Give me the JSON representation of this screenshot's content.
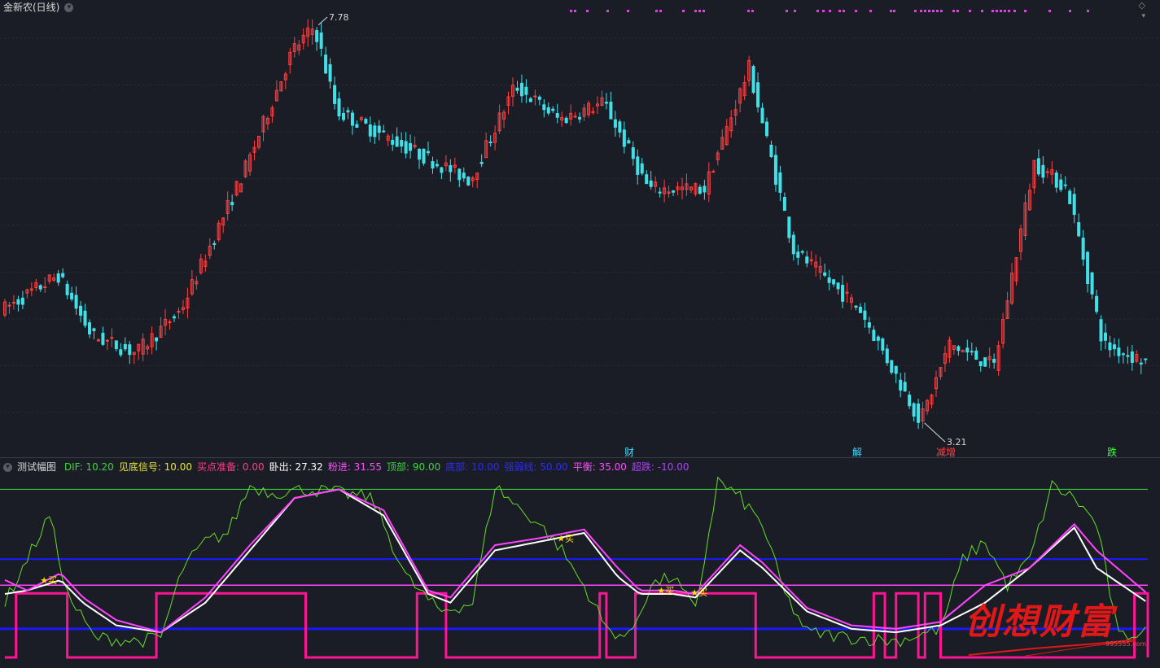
{
  "stock": {
    "title": "金新农(日线)",
    "high_label": "7.78",
    "low_label": "3.21"
  },
  "indicator": {
    "name": "测试幅图",
    "items": [
      {
        "label": "DIF:",
        "value": "10.20",
        "color": "#3cd63c"
      },
      {
        "label": "见底信号:",
        "value": "10.00",
        "color": "#e6e63a"
      },
      {
        "label": "买点准备:",
        "value": "0.00",
        "color": "#ff3c8c"
      },
      {
        "label": "卧出:",
        "value": "27.32",
        "color": "#ffffff"
      },
      {
        "label": "粉进:",
        "value": "31.55",
        "color": "#ff4cff"
      },
      {
        "label": "顶部:",
        "value": "90.00",
        "color": "#3cd63c"
      },
      {
        "label": "底部:",
        "value": "10.00",
        "color": "#2b2bff"
      },
      {
        "label": "强弱线:",
        "value": "50.00",
        "color": "#2b2bff"
      },
      {
        "label": "平衡:",
        "value": "35.00",
        "color": "#ff4cff"
      },
      {
        "label": "超跌:",
        "value": "-10.00",
        "color": "#b040ff"
      }
    ]
  },
  "markers": [
    {
      "text": "财",
      "color": "#40d8ff"
    },
    {
      "text": "解",
      "color": "#40d8ff"
    },
    {
      "text": "减增",
      "color": "#ff4040"
    },
    {
      "text": "跌",
      "color": "#40ff40"
    }
  ],
  "buy_label": "买",
  "watermark": {
    "text": "创想财富",
    "sub": "995555.com"
  },
  "colors": {
    "up": "#ff4040",
    "down": "#40e0e8",
    "white": "#ffffff",
    "magenta": "#ff44ff",
    "green": "#66dd22",
    "blue": "#1a1aff",
    "pink": "#ff1493"
  },
  "chart_data": [
    {
      "type": "candlestick",
      "anchors": [
        [
          0,
          4.5
        ],
        [
          25,
          4.9
        ],
        [
          40,
          4.2
        ],
        [
          60,
          4.0
        ],
        [
          80,
          4.5
        ],
        [
          110,
          6.2
        ],
        [
          130,
          7.5
        ],
        [
          140,
          7.78
        ],
        [
          150,
          6.8
        ],
        [
          180,
          6.4
        ],
        [
          210,
          6.0
        ],
        [
          230,
          7.1
        ],
        [
          250,
          6.7
        ],
        [
          270,
          6.9
        ],
        [
          290,
          5.9
        ],
        [
          315,
          5.9
        ],
        [
          335,
          7.3
        ],
        [
          355,
          5.2
        ],
        [
          385,
          4.5
        ],
        [
          412,
          3.21
        ],
        [
          425,
          4.1
        ],
        [
          445,
          3.85
        ],
        [
          463,
          6.2
        ],
        [
          478,
          5.9
        ],
        [
          494,
          4.1
        ],
        [
          513,
          3.9
        ]
      ]
    },
    {
      "type": "line",
      "ylim": [
        -12,
        100
      ],
      "levels": [
        90,
        50,
        35,
        10
      ],
      "series": [
        {
          "key": "green",
          "anchors": [
            [
              0,
              25
            ],
            [
              10,
              50
            ],
            [
              20,
              75
            ],
            [
              28,
              30
            ],
            [
              40,
              5
            ],
            [
              60,
              3
            ],
            [
              70,
              5
            ],
            [
              80,
              45
            ],
            [
              90,
              60
            ],
            [
              100,
              65
            ],
            [
              110,
              92
            ],
            [
              120,
              88
            ],
            [
              135,
              90
            ],
            [
              150,
              88
            ],
            [
              165,
              85
            ],
            [
              180,
              40
            ],
            [
              195,
              20
            ],
            [
              210,
              25
            ],
            [
              220,
              92
            ],
            [
              230,
              80
            ],
            [
              240,
              70
            ],
            [
              250,
              55
            ],
            [
              262,
              30
            ],
            [
              270,
              10
            ],
            [
              280,
              5
            ],
            [
              290,
              35
            ],
            [
              300,
              40
            ],
            [
              310,
              20
            ],
            [
              320,
              95
            ],
            [
              330,
              85
            ],
            [
              340,
              70
            ],
            [
              350,
              30
            ],
            [
              360,
              8
            ],
            [
              380,
              5
            ],
            [
              400,
              3
            ],
            [
              420,
              10
            ],
            [
              430,
              50
            ],
            [
              440,
              60
            ],
            [
              450,
              35
            ],
            [
              460,
              50
            ],
            [
              470,
              92
            ],
            [
              480,
              85
            ],
            [
              490,
              70
            ],
            [
              500,
              5
            ],
            [
              513,
              10
            ]
          ]
        },
        {
          "key": "white",
          "anchors": [
            [
              0,
              30
            ],
            [
              10,
              32
            ],
            [
              25,
              38
            ],
            [
              35,
              25
            ],
            [
              50,
              12
            ],
            [
              70,
              8
            ],
            [
              90,
              25
            ],
            [
              110,
              55
            ],
            [
              130,
              85
            ],
            [
              150,
              90
            ],
            [
              170,
              75
            ],
            [
              190,
              30
            ],
            [
              200,
              25
            ],
            [
              220,
              55
            ],
            [
              240,
              60
            ],
            [
              260,
              65
            ],
            [
              275,
              40
            ],
            [
              285,
              30
            ],
            [
              300,
              30
            ],
            [
              310,
              28
            ],
            [
              330,
              55
            ],
            [
              340,
              45
            ],
            [
              360,
              20
            ],
            [
              380,
              10
            ],
            [
              400,
              8
            ],
            [
              420,
              12
            ],
            [
              440,
              25
            ],
            [
              460,
              45
            ],
            [
              480,
              68
            ],
            [
              490,
              45
            ],
            [
              513,
              25
            ]
          ]
        },
        {
          "key": "magenta",
          "anchors": [
            [
              0,
              38
            ],
            [
              10,
              32
            ],
            [
              25,
              42
            ],
            [
              35,
              28
            ],
            [
              50,
              15
            ],
            [
              70,
              8
            ],
            [
              90,
              28
            ],
            [
              110,
              58
            ],
            [
              130,
              85
            ],
            [
              150,
              90
            ],
            [
              170,
              78
            ],
            [
              190,
              32
            ],
            [
              200,
              28
            ],
            [
              220,
              58
            ],
            [
              240,
              62
            ],
            [
              260,
              67
            ],
            [
              275,
              45
            ],
            [
              285,
              32
            ],
            [
              300,
              32
            ],
            [
              310,
              30
            ],
            [
              330,
              58
            ],
            [
              340,
              48
            ],
            [
              360,
              22
            ],
            [
              380,
              12
            ],
            [
              400,
              10
            ],
            [
              420,
              14
            ],
            [
              440,
              35
            ],
            [
              460,
              45
            ],
            [
              480,
              70
            ],
            [
              490,
              55
            ],
            [
              513,
              30
            ]
          ]
        }
      ],
      "step": [
        [
          0,
          0
        ],
        [
          5,
          1
        ],
        [
          28,
          0
        ],
        [
          68,
          1
        ],
        [
          135,
          0
        ],
        [
          185,
          1
        ],
        [
          198,
          0
        ],
        [
          267,
          1
        ],
        [
          270,
          0
        ],
        [
          283,
          1
        ],
        [
          337,
          0
        ],
        [
          390,
          1
        ],
        [
          395,
          0
        ],
        [
          400,
          1
        ],
        [
          410,
          0
        ],
        [
          413,
          1
        ],
        [
          420,
          0
        ],
        [
          507,
          1
        ],
        [
          513,
          0
        ]
      ],
      "buy_markers": [
        {
          "x": 18,
          "y": 38
        },
        {
          "x": 250,
          "y": 62
        },
        {
          "x": 295,
          "y": 32
        },
        {
          "x": 310,
          "y": 31
        }
      ]
    }
  ]
}
